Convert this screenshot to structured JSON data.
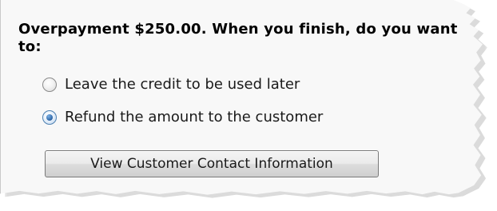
{
  "dialog": {
    "heading": "Overpayment $250.00. When you finish, do you want to:",
    "options": [
      {
        "label": "Leave the credit to be used later",
        "selected": false
      },
      {
        "label": "Refund the amount to the customer",
        "selected": true
      }
    ],
    "contact_button_label": "View Customer Contact Information"
  },
  "colors": {
    "panel_background": "#f8f8f8",
    "radio_selected": "#2b63a3"
  },
  "icons": {
    "option_unselected": "radio-unselected-icon",
    "option_selected": "radio-selected-icon"
  }
}
